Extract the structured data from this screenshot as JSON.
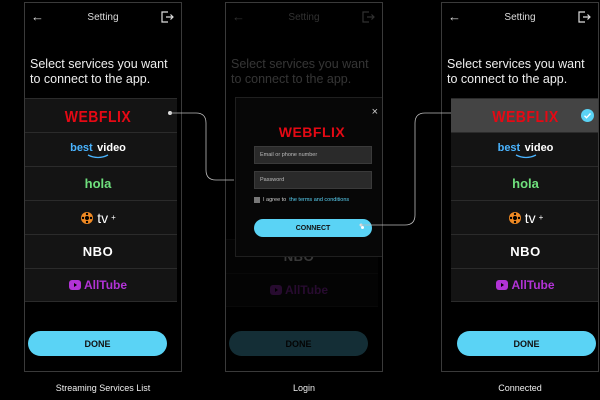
{
  "screens": {
    "list": {
      "title": "Setting",
      "prompt": "Select services you want to connect to the app.",
      "services": [
        {
          "id": "webflix",
          "label": "WEBFLIX"
        },
        {
          "id": "best-video",
          "label1": "best",
          "label2": "video"
        },
        {
          "id": "hola",
          "label": "hola"
        },
        {
          "id": "tv-plus",
          "label": "tv",
          "sup": "+"
        },
        {
          "id": "nbo",
          "label": "NBO"
        },
        {
          "id": "alltube",
          "label": "AllTube"
        }
      ],
      "done_label": "DONE"
    },
    "login": {
      "title": "Setting",
      "prompt": "Select services you want to connect to the app.",
      "logo": "WEBFLIX",
      "close": "×",
      "email_placeholder": "Email or phone number",
      "password_placeholder": "Password",
      "agree_prefix": "I agree to",
      "agree_link": "the terms and conditions",
      "connect_label": "CONNECT",
      "behind_nbo": "NBO",
      "behind_alltube": "AllTube",
      "done_label": "DONE"
    },
    "connected": {
      "title": "Setting",
      "prompt": "Select services you want to connect to the app.",
      "services": [
        {
          "id": "webflix",
          "label": "WEBFLIX",
          "selected": true
        },
        {
          "id": "best-video",
          "label1": "best",
          "label2": "video"
        },
        {
          "id": "hola",
          "label": "hola"
        },
        {
          "id": "tv-plus",
          "label": "tv",
          "sup": "+"
        },
        {
          "id": "nbo",
          "label": "NBO"
        },
        {
          "id": "alltube",
          "label": "AllTube"
        }
      ],
      "done_label": "DONE"
    }
  },
  "captions": {
    "list": "Streaming Services List",
    "login": "Login",
    "connected": "Connected"
  },
  "icons": {
    "back": "back-arrow-icon",
    "exit": "exit-icon",
    "check": "checkmark-icon",
    "close": "close-icon"
  },
  "colors": {
    "background": "#000000",
    "accent": "#5ad3f5",
    "webflix": "#e50914",
    "best": "#4ab4ff",
    "hola": "#6fe07d",
    "alltube": "#b233d6",
    "selected_row": "#444444"
  }
}
